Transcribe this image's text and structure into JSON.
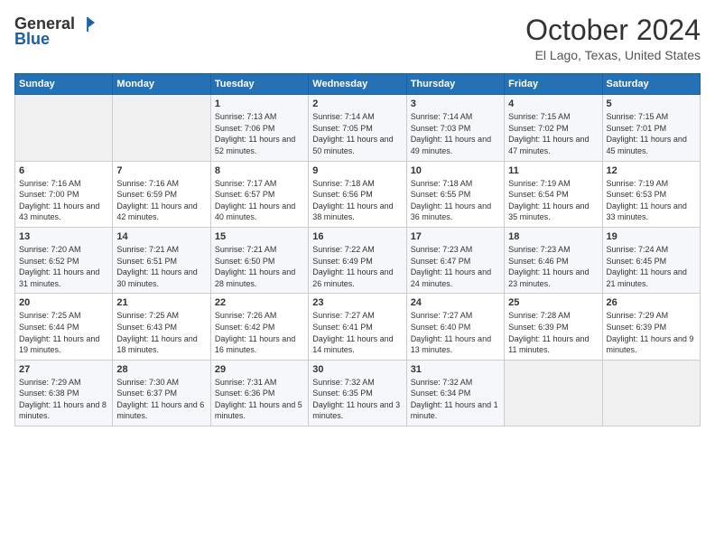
{
  "header": {
    "logo_general": "General",
    "logo_blue": "Blue",
    "month": "October 2024",
    "location": "El Lago, Texas, United States"
  },
  "days_of_week": [
    "Sunday",
    "Monday",
    "Tuesday",
    "Wednesday",
    "Thursday",
    "Friday",
    "Saturday"
  ],
  "weeks": [
    [
      {
        "day": "",
        "sunrise": "",
        "sunset": "",
        "daylight": ""
      },
      {
        "day": "",
        "sunrise": "",
        "sunset": "",
        "daylight": ""
      },
      {
        "day": "1",
        "sunrise": "Sunrise: 7:13 AM",
        "sunset": "Sunset: 7:06 PM",
        "daylight": "Daylight: 11 hours and 52 minutes."
      },
      {
        "day": "2",
        "sunrise": "Sunrise: 7:14 AM",
        "sunset": "Sunset: 7:05 PM",
        "daylight": "Daylight: 11 hours and 50 minutes."
      },
      {
        "day": "3",
        "sunrise": "Sunrise: 7:14 AM",
        "sunset": "Sunset: 7:03 PM",
        "daylight": "Daylight: 11 hours and 49 minutes."
      },
      {
        "day": "4",
        "sunrise": "Sunrise: 7:15 AM",
        "sunset": "Sunset: 7:02 PM",
        "daylight": "Daylight: 11 hours and 47 minutes."
      },
      {
        "day": "5",
        "sunrise": "Sunrise: 7:15 AM",
        "sunset": "Sunset: 7:01 PM",
        "daylight": "Daylight: 11 hours and 45 minutes."
      }
    ],
    [
      {
        "day": "6",
        "sunrise": "Sunrise: 7:16 AM",
        "sunset": "Sunset: 7:00 PM",
        "daylight": "Daylight: 11 hours and 43 minutes."
      },
      {
        "day": "7",
        "sunrise": "Sunrise: 7:16 AM",
        "sunset": "Sunset: 6:59 PM",
        "daylight": "Daylight: 11 hours and 42 minutes."
      },
      {
        "day": "8",
        "sunrise": "Sunrise: 7:17 AM",
        "sunset": "Sunset: 6:57 PM",
        "daylight": "Daylight: 11 hours and 40 minutes."
      },
      {
        "day": "9",
        "sunrise": "Sunrise: 7:18 AM",
        "sunset": "Sunset: 6:56 PM",
        "daylight": "Daylight: 11 hours and 38 minutes."
      },
      {
        "day": "10",
        "sunrise": "Sunrise: 7:18 AM",
        "sunset": "Sunset: 6:55 PM",
        "daylight": "Daylight: 11 hours and 36 minutes."
      },
      {
        "day": "11",
        "sunrise": "Sunrise: 7:19 AM",
        "sunset": "Sunset: 6:54 PM",
        "daylight": "Daylight: 11 hours and 35 minutes."
      },
      {
        "day": "12",
        "sunrise": "Sunrise: 7:19 AM",
        "sunset": "Sunset: 6:53 PM",
        "daylight": "Daylight: 11 hours and 33 minutes."
      }
    ],
    [
      {
        "day": "13",
        "sunrise": "Sunrise: 7:20 AM",
        "sunset": "Sunset: 6:52 PM",
        "daylight": "Daylight: 11 hours and 31 minutes."
      },
      {
        "day": "14",
        "sunrise": "Sunrise: 7:21 AM",
        "sunset": "Sunset: 6:51 PM",
        "daylight": "Daylight: 11 hours and 30 minutes."
      },
      {
        "day": "15",
        "sunrise": "Sunrise: 7:21 AM",
        "sunset": "Sunset: 6:50 PM",
        "daylight": "Daylight: 11 hours and 28 minutes."
      },
      {
        "day": "16",
        "sunrise": "Sunrise: 7:22 AM",
        "sunset": "Sunset: 6:49 PM",
        "daylight": "Daylight: 11 hours and 26 minutes."
      },
      {
        "day": "17",
        "sunrise": "Sunrise: 7:23 AM",
        "sunset": "Sunset: 6:47 PM",
        "daylight": "Daylight: 11 hours and 24 minutes."
      },
      {
        "day": "18",
        "sunrise": "Sunrise: 7:23 AM",
        "sunset": "Sunset: 6:46 PM",
        "daylight": "Daylight: 11 hours and 23 minutes."
      },
      {
        "day": "19",
        "sunrise": "Sunrise: 7:24 AM",
        "sunset": "Sunset: 6:45 PM",
        "daylight": "Daylight: 11 hours and 21 minutes."
      }
    ],
    [
      {
        "day": "20",
        "sunrise": "Sunrise: 7:25 AM",
        "sunset": "Sunset: 6:44 PM",
        "daylight": "Daylight: 11 hours and 19 minutes."
      },
      {
        "day": "21",
        "sunrise": "Sunrise: 7:25 AM",
        "sunset": "Sunset: 6:43 PM",
        "daylight": "Daylight: 11 hours and 18 minutes."
      },
      {
        "day": "22",
        "sunrise": "Sunrise: 7:26 AM",
        "sunset": "Sunset: 6:42 PM",
        "daylight": "Daylight: 11 hours and 16 minutes."
      },
      {
        "day": "23",
        "sunrise": "Sunrise: 7:27 AM",
        "sunset": "Sunset: 6:41 PM",
        "daylight": "Daylight: 11 hours and 14 minutes."
      },
      {
        "day": "24",
        "sunrise": "Sunrise: 7:27 AM",
        "sunset": "Sunset: 6:40 PM",
        "daylight": "Daylight: 11 hours and 13 minutes."
      },
      {
        "day": "25",
        "sunrise": "Sunrise: 7:28 AM",
        "sunset": "Sunset: 6:39 PM",
        "daylight": "Daylight: 11 hours and 11 minutes."
      },
      {
        "day": "26",
        "sunrise": "Sunrise: 7:29 AM",
        "sunset": "Sunset: 6:39 PM",
        "daylight": "Daylight: 11 hours and 9 minutes."
      }
    ],
    [
      {
        "day": "27",
        "sunrise": "Sunrise: 7:29 AM",
        "sunset": "Sunset: 6:38 PM",
        "daylight": "Daylight: 11 hours and 8 minutes."
      },
      {
        "day": "28",
        "sunrise": "Sunrise: 7:30 AM",
        "sunset": "Sunset: 6:37 PM",
        "daylight": "Daylight: 11 hours and 6 minutes."
      },
      {
        "day": "29",
        "sunrise": "Sunrise: 7:31 AM",
        "sunset": "Sunset: 6:36 PM",
        "daylight": "Daylight: 11 hours and 5 minutes."
      },
      {
        "day": "30",
        "sunrise": "Sunrise: 7:32 AM",
        "sunset": "Sunset: 6:35 PM",
        "daylight": "Daylight: 11 hours and 3 minutes."
      },
      {
        "day": "31",
        "sunrise": "Sunrise: 7:32 AM",
        "sunset": "Sunset: 6:34 PM",
        "daylight": "Daylight: 11 hours and 1 minute."
      },
      {
        "day": "",
        "sunrise": "",
        "sunset": "",
        "daylight": ""
      },
      {
        "day": "",
        "sunrise": "",
        "sunset": "",
        "daylight": ""
      }
    ]
  ]
}
